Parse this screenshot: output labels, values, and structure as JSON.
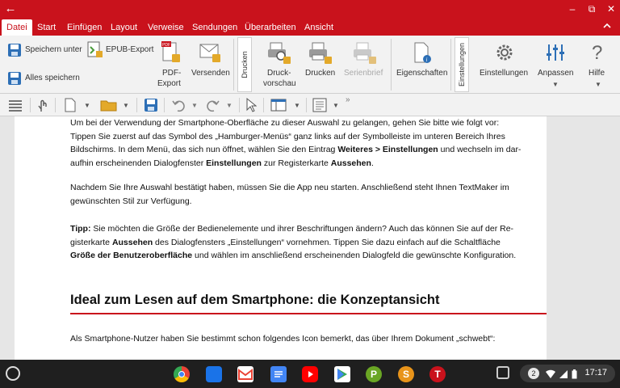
{
  "window": {
    "controls": {
      "back": "←",
      "minimize": "–",
      "restore": "⧉",
      "close": "✕"
    }
  },
  "menubar": {
    "tabs": [
      "Datei",
      "Start",
      "Einfügen",
      "Layout",
      "Verweise",
      "Sendungen",
      "Überarbeiten",
      "Ansicht"
    ],
    "active_tab": "Datei",
    "collapse_icon": "chevron-up-icon"
  },
  "ribbon": {
    "save_as": "Speichern unter",
    "save_all": "Alles speichern",
    "epub_export": "EPUB-Export",
    "pdf_export_line1": "PDF-",
    "pdf_export_line2": "Export",
    "send": "Versenden",
    "group_print": "Drucken",
    "print_preview_line1": "Druck-",
    "print_preview_line2": "vorschau",
    "print": "Drucken",
    "serial_letter": "Serienbrief",
    "properties": "Eigenschaften",
    "group_settings": "Einstellungen",
    "settings": "Einstellungen",
    "customize": "Anpassen",
    "help": "Hilfe"
  },
  "document": {
    "p1": [
      "Um bei der Verwendung der Smartphone-Oberfläche zu dieser Auswahl zu gelangen, gehen Sie bitte wie folgt vor:",
      "Tippen Sie zuerst auf das Symbol des „Hamburger-Menüs“ ganz links auf der Symbolleiste im unteren Bereich Ihres",
      "Bildschirms. In dem Menü, das sich nun öffnet, wählen Sie den Eintrag ",
      "Weiteres > Einstellungen",
      " und wechseln im dar-",
      "aufhin erscheinenden Dialogfenster ",
      "Einstellungen",
      " zur Registerkarte ",
      "Aussehen",
      "."
    ],
    "p2": [
      "Nachdem Sie Ihre Auswahl bestätigt haben, müssen Sie die App neu starten. Anschließend steht Ihnen TextMaker im",
      "gewünschten Stil zur Verfügung."
    ],
    "p3": [
      "Tipp:",
      " Sie möchten die Größe der Bedienelemente und ihrer Beschriftungen ändern? Auch das können Sie auf der Re-",
      "gisterkarte ",
      "Aussehen",
      " des Dialogfensters „Einstellungen“ vornehmen. Tippen Sie dazu einfach auf die Schaltfläche",
      "Größe der Benutzeroberfläche",
      " und wählen im anschließend erscheinenden Dialogfeld die gewünschte Konfiguration."
    ],
    "heading": "Ideal zum Lesen auf dem Smartphone: die Konzeptansicht",
    "p4": "Als Smartphone-Nutzer haben Sie bestimmt schon folgendes Icon bemerkt, das über Ihrem Dokument „schwebt“:"
  },
  "taskbar": {
    "apps": [
      "chrome-icon",
      "files-icon",
      "gmail-icon",
      "docs-icon",
      "youtube-icon",
      "play-store-icon",
      "planmaker-icon",
      "presentations-icon",
      "textmaker-icon"
    ],
    "app_letters": {
      "planmaker": "P",
      "presentations": "S",
      "textmaker": "T"
    },
    "notification_count": "2",
    "time": "17:17"
  },
  "colors": {
    "accent": "#c9121c",
    "ribbon_bg": "#f2f2f2",
    "taskbar_bg": "#1f1f1f"
  }
}
